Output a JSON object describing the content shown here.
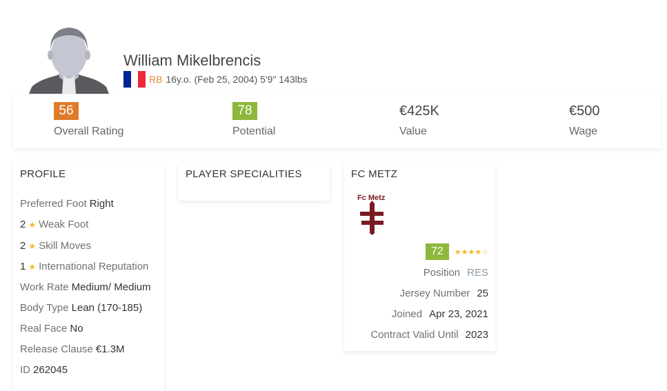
{
  "player": {
    "name": "William Mikelbrencis",
    "position": "RB",
    "details": "16y.o. (Feb 25, 2004) 5'9\" 143lbs",
    "flag_colors": [
      "#002395",
      "#ffffff",
      "#ed2939"
    ]
  },
  "stats": [
    {
      "value": "56",
      "label": "Overall Rating",
      "badge_color": "#e07b2a"
    },
    {
      "value": "78",
      "label": "Potential",
      "badge_color": "#8db83c"
    },
    {
      "value": "€425K",
      "label": "Value"
    },
    {
      "value": "€500",
      "label": "Wage"
    }
  ],
  "profile": {
    "title": "PROFILE",
    "preferred_foot": {
      "label": "Preferred Foot",
      "value": "Right"
    },
    "weak_foot": {
      "num": "2",
      "label": "Weak Foot"
    },
    "skill_moves": {
      "num": "2",
      "label": "Skill Moves"
    },
    "intl_rep": {
      "num": "1",
      "label": "International Reputation"
    },
    "work_rate": {
      "label": "Work Rate",
      "value": "Medium/ Medium"
    },
    "body_type": {
      "label": "Body Type",
      "value": "Lean (170-185)"
    },
    "real_face": {
      "label": "Real Face",
      "value": "No"
    },
    "release_clause": {
      "label": "Release Clause",
      "value": "€1.3M"
    },
    "id": {
      "label": "ID",
      "value": "262045"
    }
  },
  "specialities": {
    "title": "PLAYER SPECIALITIES"
  },
  "club": {
    "title": "FC METZ",
    "logo_text": "Fc Metz",
    "logo_color": "#7a1b22",
    "rating": "72",
    "stars": "★★★★☆",
    "position": {
      "label": "Position",
      "value": "RES"
    },
    "jersey": {
      "label": "Jersey Number",
      "value": "25"
    },
    "joined": {
      "label": "Joined",
      "value": "Apr 23, 2021"
    },
    "contract": {
      "label": "Contract Valid Until",
      "value": "2023"
    }
  },
  "icons": {
    "star": "★",
    "avatar": "player-silhouette"
  }
}
